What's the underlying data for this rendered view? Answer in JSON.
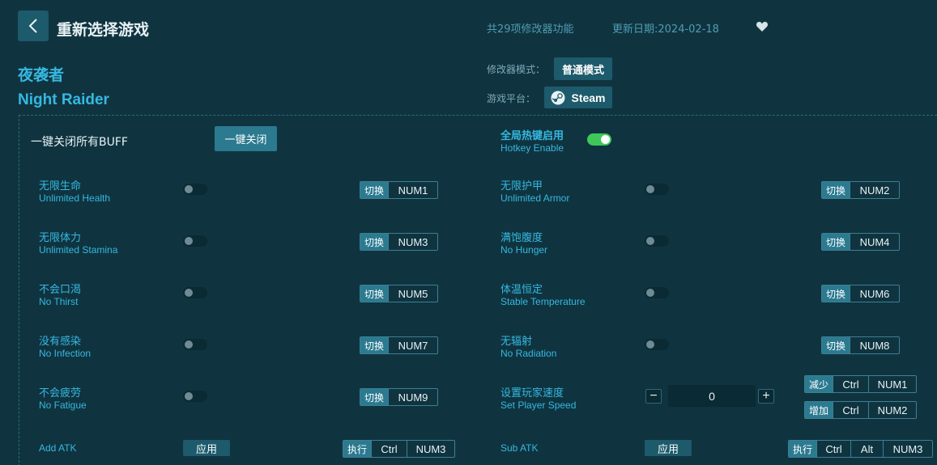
{
  "header": {
    "title": "重新选择游戏",
    "feature_count": "共29项修改器功能",
    "update_date": "更新日期:2024-02-18"
  },
  "game": {
    "name_cn": "夜袭者",
    "name_en": "Night Raider"
  },
  "mode": {
    "label": "修改器模式：",
    "value": "普通模式"
  },
  "platform": {
    "label": "游戏平台：",
    "value": "Steam"
  },
  "buff": {
    "label": "一键关闭所有BUFF",
    "button": "一键关闭"
  },
  "hotkey": {
    "label_cn": "全局热键启用",
    "label_en": "Hotkey Enable",
    "enabled": true
  },
  "cheats": [
    {
      "cn": "无限生命",
      "en": "Unlimited Health",
      "action": "切换",
      "key": "NUM1"
    },
    {
      "cn": "无限护甲",
      "en": "Unlimited Armor",
      "action": "切换",
      "key": "NUM2"
    },
    {
      "cn": "无限体力",
      "en": "Unlimited Stamina",
      "action": "切换",
      "key": "NUM3"
    },
    {
      "cn": "满饱腹度",
      "en": "No Hunger",
      "action": "切换",
      "key": "NUM4"
    },
    {
      "cn": "不会口渴",
      "en": "No Thirst",
      "action": "切换",
      "key": "NUM5"
    },
    {
      "cn": "体温恒定",
      "en": "Stable Temperature",
      "action": "切换",
      "key": "NUM6"
    },
    {
      "cn": "没有感染",
      "en": "No Infection",
      "action": "切换",
      "key": "NUM7"
    },
    {
      "cn": "无辐射",
      "en": "No Radiation",
      "action": "切换",
      "key": "NUM8"
    },
    {
      "cn": "不会疲劳",
      "en": "No Fatigue",
      "action": "切换",
      "key": "NUM9"
    }
  ],
  "speed": {
    "cn": "设置玩家速度",
    "en": "Set Player Speed",
    "value": "0",
    "minus": "−",
    "plus": "+",
    "decrease": {
      "action": "减少",
      "mod": "Ctrl",
      "key": "NUM1"
    },
    "increase": {
      "action": "增加",
      "mod": "Ctrl",
      "key": "NUM2"
    }
  },
  "add_atk": {
    "en": "Add ATK",
    "apply": "应用",
    "action": "执行",
    "mod": "Ctrl",
    "key": "NUM3"
  },
  "sub_atk": {
    "en": "Sub ATK",
    "apply": "应用",
    "action": "执行",
    "mod1": "Ctrl",
    "mod2": "Alt",
    "key": "NUM3"
  }
}
